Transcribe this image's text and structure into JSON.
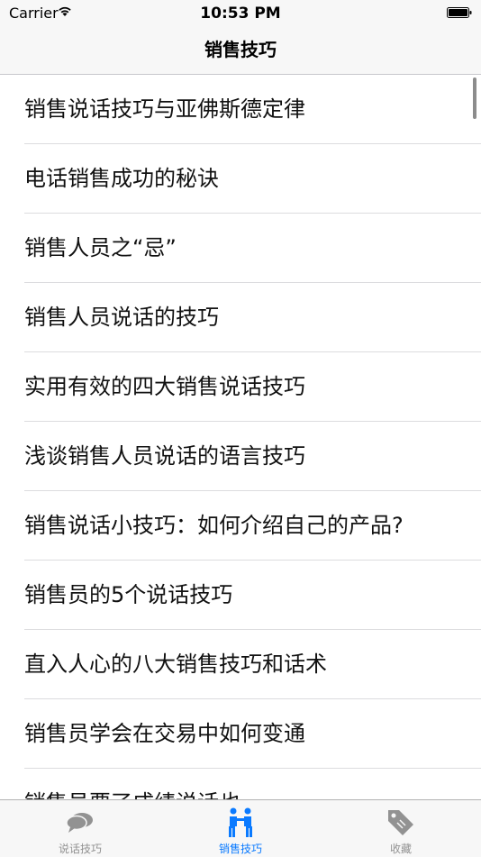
{
  "status_bar": {
    "carrier": "Carrier",
    "time": "10:53 PM"
  },
  "nav": {
    "title": "销售技巧"
  },
  "list": {
    "items": [
      "销售说话技巧与亚佛斯德定律",
      "电话销售成功的秘诀",
      "销售人员之“忌”",
      "销售人员说话的技巧",
      "实用有效的四大销售说话技巧",
      "浅谈销售人员说话的语言技巧",
      "销售说话小技巧：如何介绍自己的产品?",
      "销售员的5个说话技巧",
      "直入人心的八大销售技巧和话术",
      "销售员学会在交易中如何变通",
      "销售员要了成绩说话也"
    ]
  },
  "tab_bar": {
    "tabs": [
      {
        "label": "说话技巧",
        "icon": "speech-bubbles-icon",
        "active": false
      },
      {
        "label": "销售技巧",
        "icon": "handshake-people-icon",
        "active": true
      },
      {
        "label": "收藏",
        "icon": "tag-icon",
        "active": false
      }
    ],
    "active_color": "#0a7aff",
    "inactive_color": "#929292"
  }
}
